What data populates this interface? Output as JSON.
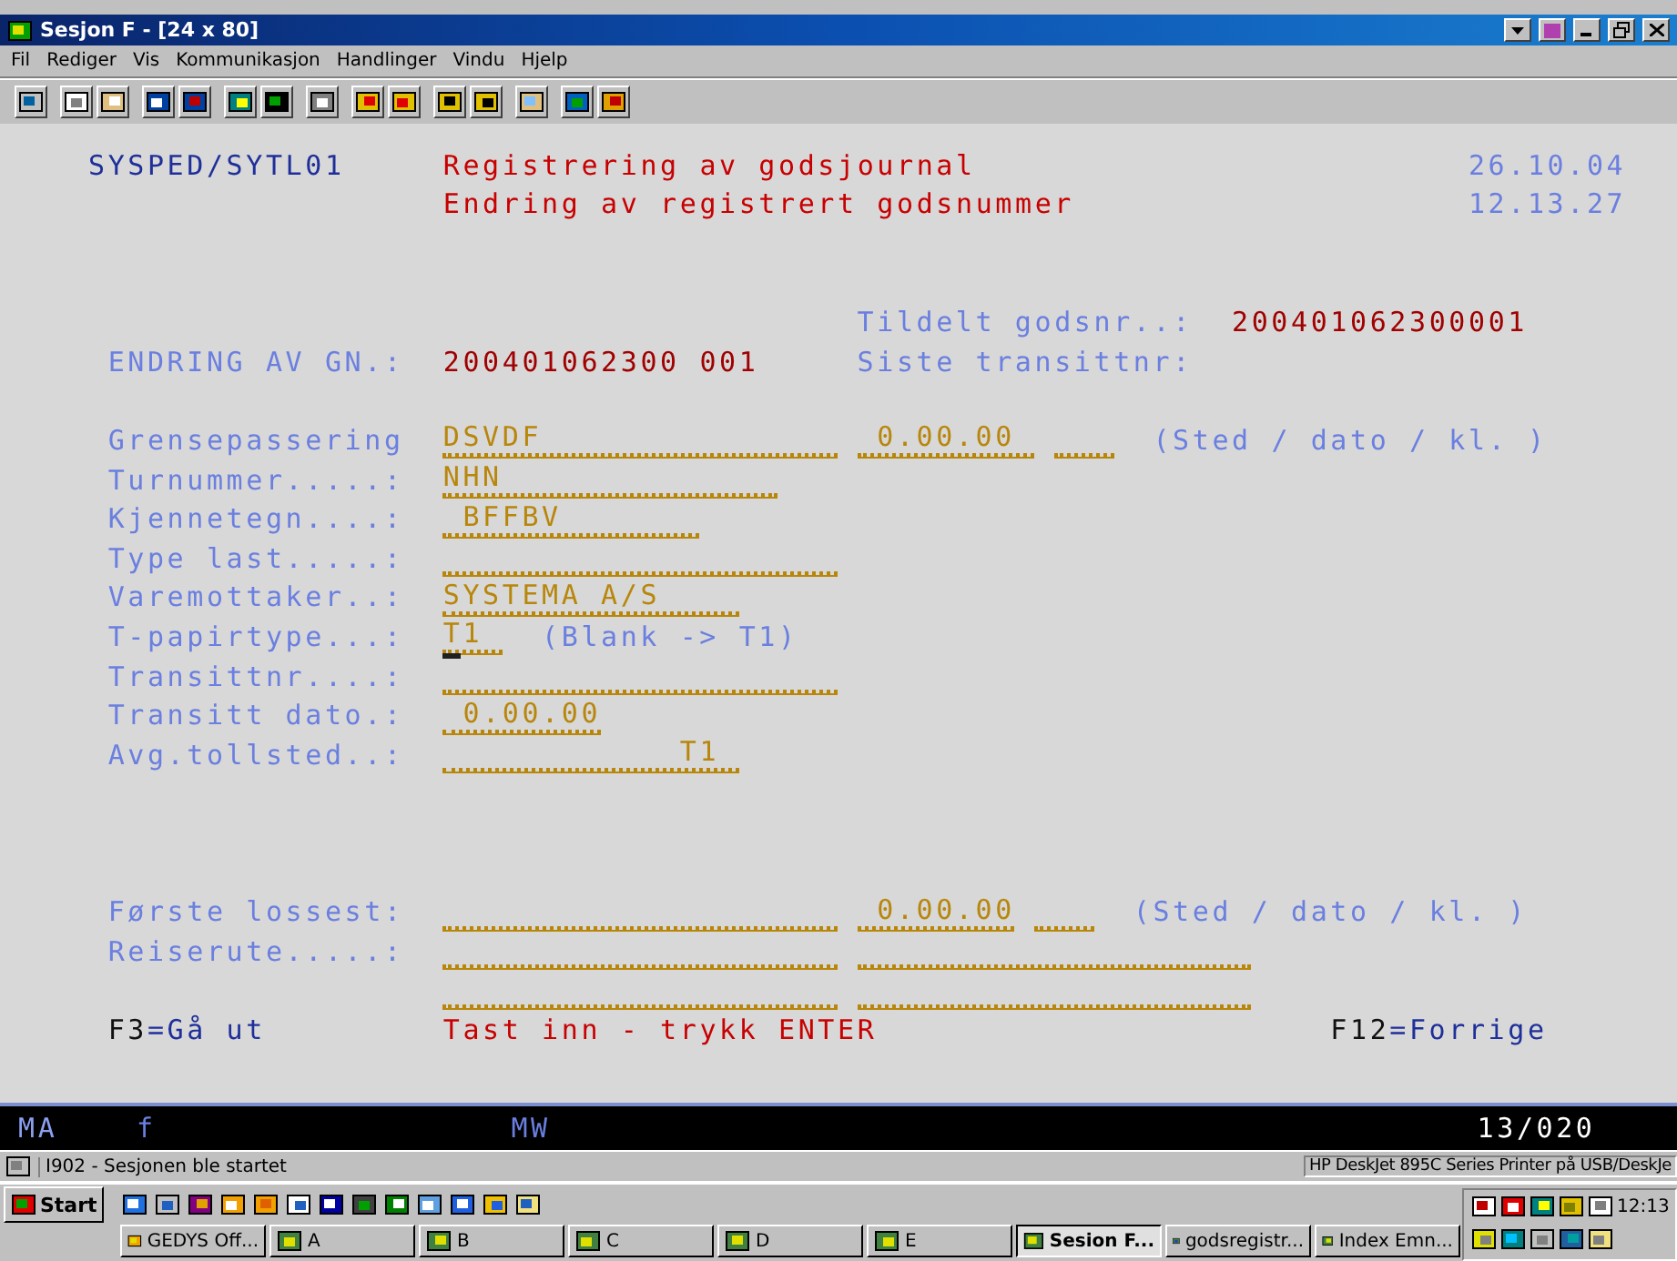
{
  "window": {
    "title": "Sesjon F - [24 x 80]"
  },
  "menu": [
    "Fil",
    "Rediger",
    "Vis",
    "Kommunikasjon",
    "Handlinger",
    "Vindu",
    "Hjelp"
  ],
  "terminal": {
    "program": "SYSPED/SYTL01",
    "title": "Registrering av godsjournal",
    "subtitle": "Endring av registrert godsnummer",
    "date": "26.10.04",
    "time": "12.13.27",
    "assigned_label": "Tildelt godsnr..:",
    "assigned_value": "200401062300001",
    "change_label": "ENDRING AV GN.:",
    "change_value": "200401062300 001",
    "last_transit_label": "Siste transittnr:",
    "rows": [
      {
        "label": "Grensepassering",
        "inputs": [
          {
            "value": "DSVDF",
            "cursor": false
          },
          {
            "value": " 0.00.00",
            "cursor": false
          },
          {
            "cursor": false
          }
        ],
        "hint": "(Sted / dato / kl. )"
      },
      {
        "label": "Turnummer.....:",
        "inputs": [
          {
            "value": "NHN",
            "cursor": false
          }
        ]
      },
      {
        "label": "Kjennetegn....:",
        "inputs": [
          {
            "value": " BFFBV",
            "cursor": false
          }
        ]
      },
      {
        "label": "Type last.....:",
        "inputs": [
          {
            "cursor": false
          }
        ]
      },
      {
        "label": "Varemottaker..:",
        "inputs": [
          {
            "value": "SYSTEMA A/S",
            "cursor": false
          }
        ]
      },
      {
        "label": "T-papirtype...:",
        "inputs": [
          {
            "value": "T1",
            "cursor": true
          }
        ],
        "hint": "(Blank -> T1)"
      },
      {
        "label": "Transittnr....:",
        "inputs": [
          {
            "cursor": false
          }
        ]
      },
      {
        "label": "Transitt dato.:",
        "inputs": [
          {
            "value": " 0.00.00",
            "cursor": false
          }
        ]
      },
      {
        "label": "Avg.tollsted..:",
        "inputs": [
          {
            "value": "            T1",
            "cursor": false
          }
        ]
      }
    ],
    "route_rows": [
      {
        "label": "Første lossest:",
        "inputs": [
          {
            "cursor": false
          },
          {
            "value": " 0.00.00",
            "cursor": false
          },
          {
            "cursor": false
          }
        ],
        "hint": "(Sted / dato / kl. )"
      },
      {
        "label": "Reiserute.....:",
        "inputs": [
          {
            "cursor": false
          },
          {
            "cursor": false
          }
        ]
      },
      {
        "inputs": [
          {
            "cursor": false
          },
          {
            "cursor": false
          }
        ]
      }
    ],
    "keys": [
      {
        "key": "F3",
        "action": "=Gå ut"
      },
      {
        "key": "F12",
        "action": "=Forrige"
      }
    ],
    "message": "Tast inn - trykk ENTER"
  },
  "status_line": {
    "mode": "MA",
    "flag": "f",
    "indicator": "MW",
    "position": "13/020"
  },
  "status_bar": {
    "message": "I902 - Sesjonen ble startet",
    "printer": "HP DeskJet 895C Series Printer på USB/DeskJe"
  },
  "taskbar": {
    "start": "Start",
    "clock": "12:13",
    "tasks": [
      {
        "label": "GEDYS Off...",
        "selected": false
      },
      {
        "label": "A",
        "selected": false
      },
      {
        "label": "B",
        "selected": false
      },
      {
        "label": "C",
        "selected": false
      },
      {
        "label": "D",
        "selected": false
      },
      {
        "label": "E",
        "selected": false
      },
      {
        "label": "Sesion F...",
        "selected": true
      },
      {
        "label": "godsregistr...",
        "selected": false
      },
      {
        "label": "Index Emn...",
        "selected": false
      }
    ]
  }
}
